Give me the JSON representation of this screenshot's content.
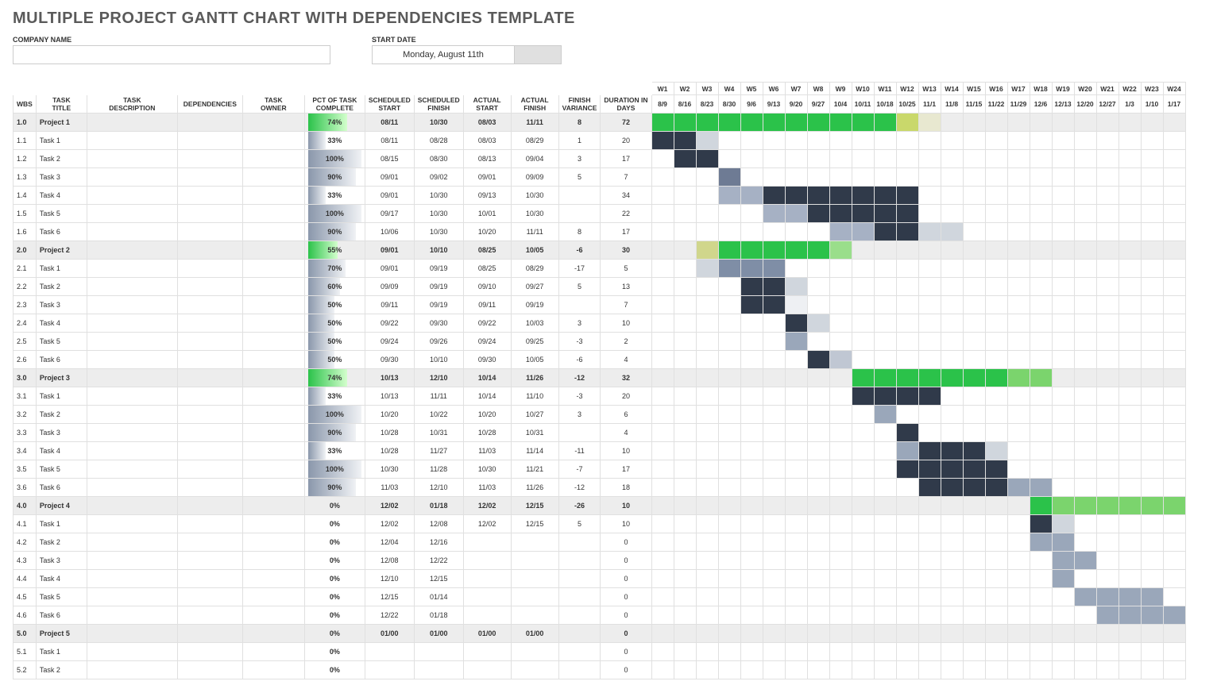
{
  "title": "MULTIPLE PROJECT GANTT CHART WITH DEPENDENCIES TEMPLATE",
  "labels": {
    "company": "COMPANY NAME",
    "startdate": "START DATE"
  },
  "startdate_value": "Monday, August 11th",
  "headers": {
    "wbs": "WBS",
    "task_title": "TASK TITLE",
    "task_desc": "TASK DESCRIPTION",
    "deps": "DEPENDENCIES",
    "owner": "TASK OWNER",
    "pct": "PCT OF TASK COMPLETE",
    "ss": "SCHEDULED START",
    "sf": "SCHEDULED FINISH",
    "as": "ACTUAL START",
    "af": "ACTUAL FINISH",
    "fv": "FINISH VARIANCE",
    "dur": "DURATION IN DAYS"
  },
  "weeks": [
    "W1",
    "W2",
    "W3",
    "W4",
    "W5",
    "W6",
    "W7",
    "W8",
    "W9",
    "W10",
    "W11",
    "W12",
    "W13",
    "W14",
    "W15",
    "W16",
    "W17",
    "W18",
    "W19",
    "W20",
    "W21",
    "W22",
    "W23",
    "W24"
  ],
  "dates": [
    "8/9",
    "8/16",
    "8/23",
    "8/30",
    "9/6",
    "9/13",
    "9/20",
    "9/27",
    "10/4",
    "10/11",
    "10/18",
    "10/25",
    "11/1",
    "11/8",
    "11/15",
    "11/22",
    "11/29",
    "12/6",
    "12/13",
    "12/20",
    "12/27",
    "1/3",
    "1/10",
    "1/17"
  ],
  "chart_data": {
    "type": "gantt",
    "start_week_date": "08/09",
    "rows": [
      {
        "wbs": "1.0",
        "title": "Project 1",
        "pct": 74,
        "ss": "08/11",
        "sf": "10/30",
        "as": "08/03",
        "af": "11/11",
        "fv": 8,
        "dur": 72,
        "proj": true,
        "bars": [
          {
            "c": "gbar-proj",
            "s": 0,
            "e": 11
          },
          {
            "c": "gbar-over",
            "s": 11,
            "e": 12
          },
          {
            "c": "",
            "s": 12,
            "e": 13,
            "bg": "#e8e8d0"
          }
        ]
      },
      {
        "wbs": "1.1",
        "title": "Task 1",
        "pct": 33,
        "ss": "08/11",
        "sf": "08/28",
        "as": "08/03",
        "af": "08/29",
        "fv": 1,
        "dur": 20,
        "bars": [
          {
            "c": "gbar-act",
            "s": 0,
            "e": 2
          },
          {
            "c": "gbar-sched",
            "s": 2,
            "e": 3,
            "bg": "#d0d6dd"
          }
        ]
      },
      {
        "wbs": "1.2",
        "title": "Task 2",
        "pct": 100,
        "ss": "08/15",
        "sf": "08/30",
        "as": "08/13",
        "af": "09/04",
        "fv": 3,
        "dur": 17,
        "bars": [
          {
            "c": "gbar-act",
            "s": 1,
            "e": 3
          }
        ]
      },
      {
        "wbs": "1.3",
        "title": "Task 3",
        "pct": 90,
        "ss": "09/01",
        "sf": "09/02",
        "as": "09/01",
        "af": "09/09",
        "fv": 5,
        "dur": 7,
        "bars": [
          {
            "c": "gbar-sched",
            "s": 3,
            "e": 4
          }
        ]
      },
      {
        "wbs": "1.4",
        "title": "Task 4",
        "pct": 33,
        "ss": "09/01",
        "sf": "10/30",
        "as": "09/13",
        "af": "10/30",
        "fv": "",
        "dur": 34,
        "bars": [
          {
            "c": "gbar-sched",
            "s": 3,
            "e": 5,
            "bg": "#a6b1c4"
          },
          {
            "c": "gbar-act",
            "s": 5,
            "e": 12
          }
        ]
      },
      {
        "wbs": "1.5",
        "title": "Task 5",
        "pct": 100,
        "ss": "09/17",
        "sf": "10/30",
        "as": "10/01",
        "af": "10/30",
        "fv": "",
        "dur": 22,
        "bars": [
          {
            "c": "gbar-sched",
            "s": 5,
            "e": 7,
            "bg": "#a6b1c4"
          },
          {
            "c": "gbar-act",
            "s": 7,
            "e": 12
          }
        ]
      },
      {
        "wbs": "1.6",
        "title": "Task 6",
        "pct": 90,
        "ss": "10/06",
        "sf": "10/30",
        "as": "10/20",
        "af": "11/11",
        "fv": 8,
        "dur": 17,
        "bars": [
          {
            "c": "gbar-sched",
            "s": 8,
            "e": 10,
            "bg": "#a6b1c4"
          },
          {
            "c": "gbar-act",
            "s": 10,
            "e": 12
          },
          {
            "c": "",
            "s": 12,
            "e": 14,
            "bg": "#d0d6dd"
          }
        ]
      },
      {
        "wbs": "2.0",
        "title": "Project 2",
        "pct": 55,
        "ss": "09/01",
        "sf": "10/10",
        "as": "08/25",
        "af": "10/05",
        "fv": -6,
        "dur": 30,
        "proj": true,
        "bars": [
          {
            "c": "gbar-over",
            "s": 2,
            "e": 3,
            "bg": "#d0d68c"
          },
          {
            "c": "gbar-proj",
            "s": 3,
            "e": 8
          },
          {
            "c": "",
            "s": 8,
            "e": 9,
            "bg": "#9ade8b"
          }
        ]
      },
      {
        "wbs": "2.1",
        "title": "Task 1",
        "pct": 70,
        "ss": "09/01",
        "sf": "09/19",
        "as": "08/25",
        "af": "08/29",
        "fv": -17,
        "dur": 5,
        "bars": [
          {
            "c": "",
            "s": 2,
            "e": 3,
            "bg": "#d0d6dd"
          },
          {
            "c": "gbar-sched",
            "s": 3,
            "e": 6,
            "bg": "#7f8ea6"
          }
        ]
      },
      {
        "wbs": "2.2",
        "title": "Task 2",
        "pct": 60,
        "ss": "09/09",
        "sf": "09/19",
        "as": "09/10",
        "af": "09/27",
        "fv": 5,
        "dur": 13,
        "bars": [
          {
            "c": "gbar-act",
            "s": 4,
            "e": 6
          },
          {
            "c": "",
            "s": 6,
            "e": 7,
            "bg": "#d0d6dd"
          }
        ]
      },
      {
        "wbs": "2.3",
        "title": "Task 3",
        "pct": 50,
        "ss": "09/11",
        "sf": "09/19",
        "as": "09/11",
        "af": "09/19",
        "fv": "",
        "dur": 7,
        "bars": [
          {
            "c": "gbar-act",
            "s": 4,
            "e": 6
          },
          {
            "c": "",
            "s": 6,
            "e": 7,
            "bg": "#eef0f3"
          }
        ]
      },
      {
        "wbs": "2.4",
        "title": "Task 4",
        "pct": 50,
        "ss": "09/22",
        "sf": "09/30",
        "as": "09/22",
        "af": "10/03",
        "fv": 3,
        "dur": 10,
        "bars": [
          {
            "c": "gbar-act",
            "s": 6,
            "e": 7
          },
          {
            "c": "",
            "s": 7,
            "e": 8,
            "bg": "#d0d6dd"
          }
        ]
      },
      {
        "wbs": "2.5",
        "title": "Task 5",
        "pct": 50,
        "ss": "09/24",
        "sf": "09/26",
        "as": "09/24",
        "af": "09/25",
        "fv": -3,
        "dur": 2,
        "bars": [
          {
            "c": "gbar-sched",
            "s": 6,
            "e": 7,
            "bg": "#9aa7ba"
          }
        ]
      },
      {
        "wbs": "2.6",
        "title": "Task 6",
        "pct": 50,
        "ss": "09/30",
        "sf": "10/10",
        "as": "09/30",
        "af": "10/05",
        "fv": -6,
        "dur": 4,
        "bars": [
          {
            "c": "gbar-act",
            "s": 7,
            "e": 8
          },
          {
            "c": "",
            "s": 8,
            "e": 9,
            "bg": "#c0c7d3"
          }
        ]
      },
      {
        "wbs": "3.0",
        "title": "Project 3",
        "pct": 74,
        "ss": "10/13",
        "sf": "12/10",
        "as": "10/14",
        "af": "11/26",
        "fv": -12,
        "dur": 32,
        "proj": true,
        "bars": [
          {
            "c": "gbar-proj",
            "s": 9,
            "e": 16
          },
          {
            "c": "",
            "s": 16,
            "e": 18,
            "bg": "#7bd46d"
          }
        ]
      },
      {
        "wbs": "3.1",
        "title": "Task 1",
        "pct": 33,
        "ss": "10/13",
        "sf": "11/11",
        "as": "10/14",
        "af": "11/10",
        "fv": -3,
        "dur": 20,
        "bars": [
          {
            "c": "gbar-act",
            "s": 9,
            "e": 13
          }
        ]
      },
      {
        "wbs": "3.2",
        "title": "Task 2",
        "pct": 100,
        "ss": "10/20",
        "sf": "10/22",
        "as": "10/20",
        "af": "10/27",
        "fv": 3,
        "dur": 6,
        "bars": [
          {
            "c": "gbar-sched",
            "s": 10,
            "e": 11,
            "bg": "#9aa7ba"
          }
        ]
      },
      {
        "wbs": "3.3",
        "title": "Task 3",
        "pct": 90,
        "ss": "10/28",
        "sf": "10/31",
        "as": "10/28",
        "af": "10/31",
        "fv": "",
        "dur": 4,
        "bars": [
          {
            "c": "gbar-act",
            "s": 11,
            "e": 12
          }
        ]
      },
      {
        "wbs": "3.4",
        "title": "Task 4",
        "pct": 33,
        "ss": "10/28",
        "sf": "11/27",
        "as": "11/03",
        "af": "11/14",
        "fv": -11,
        "dur": 10,
        "bars": [
          {
            "c": "gbar-sched",
            "s": 11,
            "e": 12,
            "bg": "#9aa7ba"
          },
          {
            "c": "gbar-act",
            "s": 12,
            "e": 15
          },
          {
            "c": "",
            "s": 15,
            "e": 16,
            "bg": "#d0d6dd"
          }
        ]
      },
      {
        "wbs": "3.5",
        "title": "Task 5",
        "pct": 100,
        "ss": "10/30",
        "sf": "11/28",
        "as": "10/30",
        "af": "11/21",
        "fv": -7,
        "dur": 17,
        "bars": [
          {
            "c": "gbar-act",
            "s": 11,
            "e": 16
          }
        ]
      },
      {
        "wbs": "3.6",
        "title": "Task 6",
        "pct": 90,
        "ss": "11/03",
        "sf": "12/10",
        "as": "11/03",
        "af": "11/26",
        "fv": -12,
        "dur": 18,
        "bars": [
          {
            "c": "gbar-act",
            "s": 12,
            "e": 16
          },
          {
            "c": "",
            "s": 16,
            "e": 18,
            "bg": "#9aa7ba"
          }
        ]
      },
      {
        "wbs": "4.0",
        "title": "Project 4",
        "pct": 0,
        "ss": "12/02",
        "sf": "01/18",
        "as": "12/02",
        "af": "12/15",
        "fv": -26,
        "dur": 10,
        "proj": true,
        "bars": [
          {
            "c": "gbar-proj",
            "s": 17,
            "e": 18
          },
          {
            "c": "",
            "s": 18,
            "e": 24,
            "bg": "#7bd46d"
          }
        ]
      },
      {
        "wbs": "4.1",
        "title": "Task 1",
        "pct": 0,
        "ss": "12/02",
        "sf": "12/08",
        "as": "12/02",
        "af": "12/15",
        "fv": 5,
        "dur": 10,
        "bars": [
          {
            "c": "gbar-act",
            "s": 17,
            "e": 18
          },
          {
            "c": "",
            "s": 18,
            "e": 19,
            "bg": "#d0d6dd"
          }
        ]
      },
      {
        "wbs": "4.2",
        "title": "Task 2",
        "pct": 0,
        "ss": "12/04",
        "sf": "12/16",
        "as": "",
        "af": "",
        "fv": "",
        "dur": 0,
        "bars": [
          {
            "c": "gbar-sched",
            "s": 17,
            "e": 19,
            "bg": "#9aa7ba"
          }
        ]
      },
      {
        "wbs": "4.3",
        "title": "Task 3",
        "pct": 0,
        "ss": "12/08",
        "sf": "12/22",
        "as": "",
        "af": "",
        "fv": "",
        "dur": 0,
        "bars": [
          {
            "c": "gbar-sched",
            "s": 18,
            "e": 20,
            "bg": "#9aa7ba"
          }
        ]
      },
      {
        "wbs": "4.4",
        "title": "Task 4",
        "pct": 0,
        "ss": "12/10",
        "sf": "12/15",
        "as": "",
        "af": "",
        "fv": "",
        "dur": 0,
        "bars": [
          {
            "c": "gbar-sched",
            "s": 18,
            "e": 19,
            "bg": "#9aa7ba"
          }
        ]
      },
      {
        "wbs": "4.5",
        "title": "Task 5",
        "pct": 0,
        "ss": "12/15",
        "sf": "01/14",
        "as": "",
        "af": "",
        "fv": "",
        "dur": 0,
        "bars": [
          {
            "c": "gbar-sched",
            "s": 19,
            "e": 23,
            "bg": "#9aa7ba"
          }
        ]
      },
      {
        "wbs": "4.6",
        "title": "Task 6",
        "pct": 0,
        "ss": "12/22",
        "sf": "01/18",
        "as": "",
        "af": "",
        "fv": "",
        "dur": 0,
        "bars": [
          {
            "c": "gbar-sched",
            "s": 20,
            "e": 24,
            "bg": "#9aa7ba"
          }
        ]
      },
      {
        "wbs": "5.0",
        "title": "Project 5",
        "pct": 0,
        "ss": "01/00",
        "sf": "01/00",
        "as": "01/00",
        "af": "01/00",
        "fv": "",
        "dur": 0,
        "proj": true,
        "bars": []
      },
      {
        "wbs": "5.1",
        "title": "Task 1",
        "pct": 0,
        "ss": "",
        "sf": "",
        "as": "",
        "af": "",
        "fv": "",
        "dur": 0,
        "bars": []
      },
      {
        "wbs": "5.2",
        "title": "Task 2",
        "pct": 0,
        "ss": "",
        "sf": "",
        "as": "",
        "af": "",
        "fv": "",
        "dur": 0,
        "bars": []
      }
    ]
  }
}
